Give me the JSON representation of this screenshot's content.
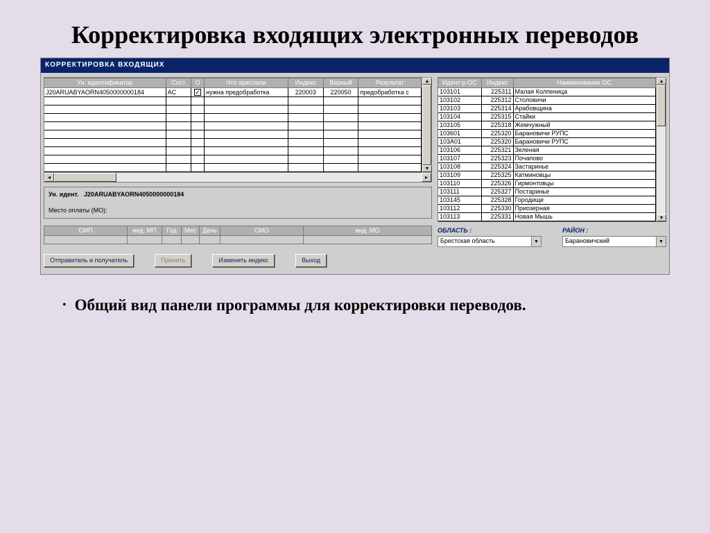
{
  "slide": {
    "title": "Корректировка входящих электронных переводов",
    "bullet": "Общий вид панели программы для корректировки переводов."
  },
  "app": {
    "title": "КОРРЕКТИРОВКА  ВХОДЯЩИХ",
    "left_grid": {
      "headers": [
        "Ун. идентификатор",
        "Сост",
        "О",
        "Что прислали",
        "Индекс",
        "Верный",
        "Результат"
      ],
      "row": {
        "id": "J20ARUABYAORN4050000000184",
        "state": "AC",
        "checked": true,
        "sent": "нужна предобработка",
        "index": "220003",
        "correct": "220050",
        "result": "предобработка с"
      }
    },
    "detail": {
      "id_label": "Ун. идент.",
      "id_value": "J20ARUABYAORN4050000000184",
      "mo_label": "Место оплаты (МО):"
    },
    "mini_headers": [
      "СМП",
      "инд. МП",
      "Год",
      "Мес",
      "День",
      "СМО",
      "инд. МО"
    ],
    "buttons": {
      "sender": "Отправитель и получатель",
      "accept": "Принять",
      "change": "Изменить индекс",
      "exit": "Выход"
    },
    "right_grid": {
      "headers": [
        "Идент-р ОС",
        "Индекс",
        "Наименование ОС"
      ],
      "rows": [
        {
          "id": "103101",
          "idx": "225311",
          "name": "Малая Колпеница"
        },
        {
          "id": "103102",
          "idx": "225312",
          "name": "Столовичи"
        },
        {
          "id": "103103",
          "idx": "225314",
          "name": "Арабовщина"
        },
        {
          "id": "103104",
          "idx": "225315",
          "name": "Стайки"
        },
        {
          "id": "103105",
          "idx": "225318",
          "name": "Жемчужный"
        },
        {
          "id": "103601",
          "idx": "225320",
          "name": "Барановичи РУПС"
        },
        {
          "id": "103A01",
          "idx": "225320",
          "name": "Барановичи РУПС"
        },
        {
          "id": "103106",
          "idx": "225321",
          "name": "Зеленая"
        },
        {
          "id": "103107",
          "idx": "225323",
          "name": "Почапово"
        },
        {
          "id": "103108",
          "idx": "225324",
          "name": "Застаринье"
        },
        {
          "id": "103109",
          "idx": "225325",
          "name": "Катминовцы"
        },
        {
          "id": "103110",
          "idx": "225326",
          "name": "Гирмонтовцы"
        },
        {
          "id": "103111",
          "idx": "225327",
          "name": "Постаринье"
        },
        {
          "id": "103145",
          "idx": "225328",
          "name": "Городище"
        },
        {
          "id": "103112",
          "idx": "225330",
          "name": "Приозерная"
        },
        {
          "id": "103113",
          "idx": "225331",
          "name": "Новая Мышь"
        }
      ]
    },
    "filters": {
      "region_label": "ОБЛАСТЬ :",
      "region_value": "Брестская область",
      "district_label": "РАЙОН :",
      "district_value": "Барановичский"
    }
  }
}
